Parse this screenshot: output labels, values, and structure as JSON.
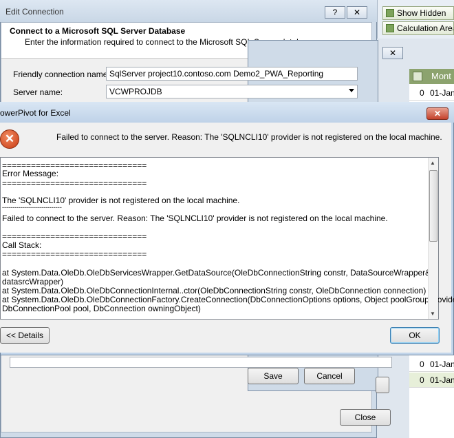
{
  "ribbon": {
    "show_hidden": "Show Hidden",
    "calculation_area": "Calculation Area"
  },
  "sheet": {
    "column_header": "Mont",
    "rows": [
      {
        "num": "0",
        "date": "01-Jan"
      },
      {
        "num": "0",
        "date": "01-Jan"
      },
      {
        "num": "0",
        "date": "01-Jan"
      }
    ]
  },
  "edit_connection": {
    "title": "Edit Connection",
    "help_button": "?",
    "close_button": "✕",
    "heading": "Connect to a Microsoft SQL Server Database",
    "subheading": "Enter the information required to connect to the Microsoft SQL Server database.",
    "friendly_name_label": "Friendly connection name:",
    "friendly_name_value": "SqlServer project10.contoso.com Demo2_PWA_Reporting",
    "server_name_label": "Server name:",
    "server_name_value": "VCWPROJDB",
    "save_label": "Save",
    "cancel_label": "Cancel",
    "close_label": "Close"
  },
  "powerpivot_dialog": {
    "title": "owerPivot for Excel",
    "close_glyph": "✕",
    "error_icon": "error-x-icon",
    "summary": "Failed to connect to the server. Reason: The 'SQLNCLI10' provider is not registered on the local machine.",
    "details_lines": [
      "==============================",
      "Error Message:",
      "==============================",
      "",
      "The 'SQLNCLI10' provider is not registered on the local machine.",
      "-----------------------------",
      "Failed to connect to the server. Reason: The 'SQLNCLI10' provider is not registered on the local machine.",
      "",
      "==============================",
      "Call Stack:",
      "==============================",
      "",
      "   at System.Data.OleDb.OleDbServicesWrapper.GetDataSource(OleDbConnectionString constr, DataSourceWrapper&",
      "datasrcWrapper)",
      "   at System.Data.OleDb.OleDbConnectionInternal..ctor(OleDbConnectionString constr, OleDbConnection connection)",
      "   at System.Data.OleDb.OleDbConnectionFactory.CreateConnection(DbConnectionOptions options, Object poolGroupProviderInfo,",
      "DbConnectionPool pool, DbConnection owningObject)"
    ],
    "details_button": "<< Details",
    "ok_button": "OK"
  }
}
